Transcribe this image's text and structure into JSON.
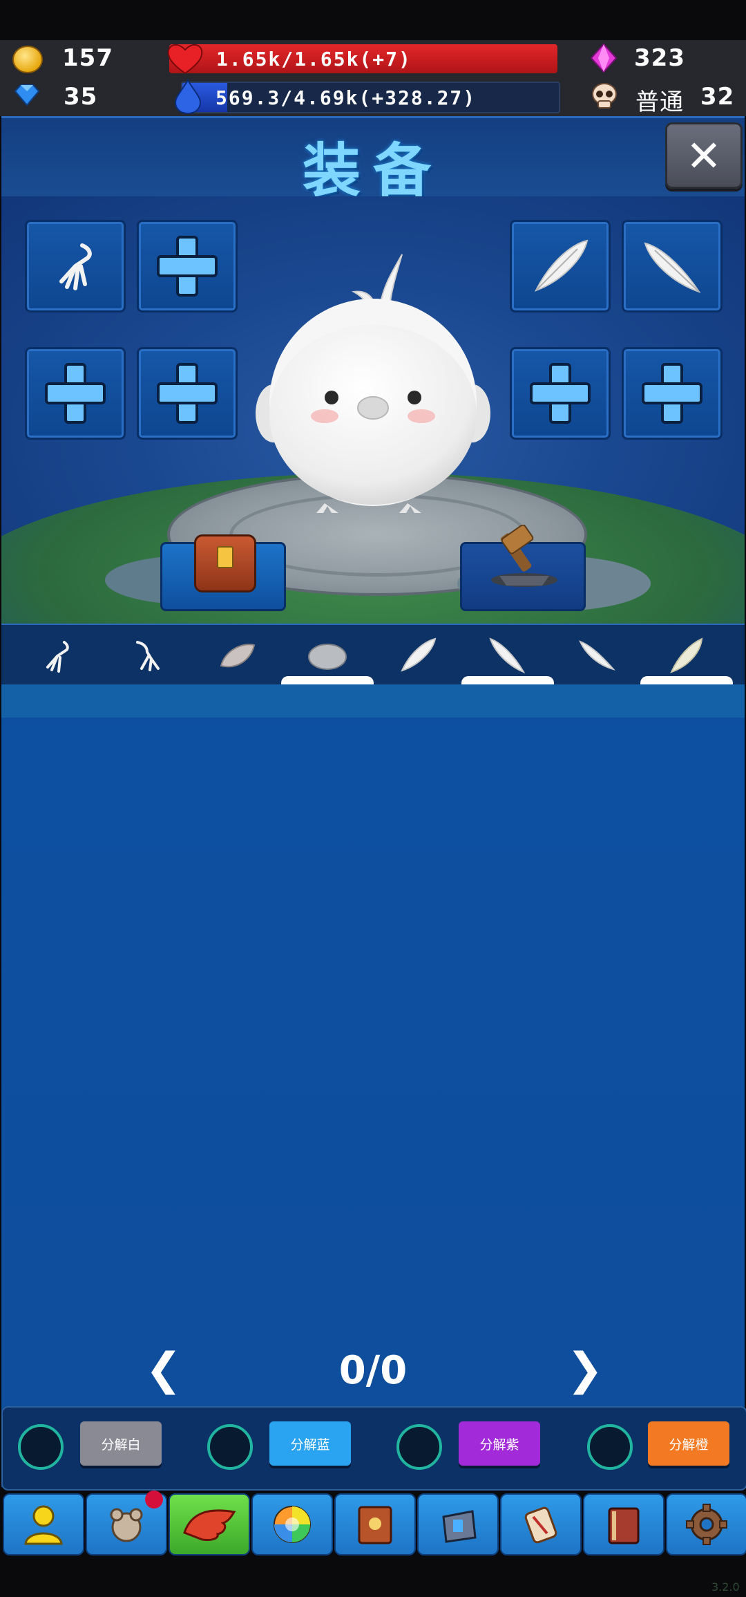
{
  "stats": {
    "gold": "157",
    "diamond": "35",
    "hp_text": "1.65k/1.65k(+7)",
    "hp_fraction": 1.0,
    "mana_text": "569.3/4.69k(+328.27)",
    "mana_fraction": 0.12,
    "gems": "323",
    "mode": "普通",
    "level": "32"
  },
  "colors": {
    "hp": "#c8191c",
    "mana": "#1b45c7",
    "accent": "#7fd6ff",
    "decompose_white": "#8a8a94",
    "decompose_blue": "#2aa3f0",
    "decompose_purple": "#a22ad8",
    "decompose_orange": "#f37a22"
  },
  "title": "装备",
  "close_icon": "close-icon",
  "equipment_slots": {
    "left": [
      "claw-icon",
      "plus-icon",
      "plus-icon",
      "plus-icon"
    ],
    "right": [
      "feather-icon",
      "feather-icon",
      "plus-icon",
      "plus-icon"
    ]
  },
  "scene_buttons": [
    "backpack-icon",
    "forge-hammer-icon"
  ],
  "item_strip": [
    "claw-icon",
    "claw-icon",
    "feather-icon",
    "stone-icon",
    "feather-icon",
    "feather-icon",
    "feather-icon",
    "feather-icon"
  ],
  "pager": {
    "text": "0/0"
  },
  "decompose": {
    "white": "分解白",
    "blue": "分解蓝",
    "purple": "分解紫",
    "orange": "分解橙"
  },
  "nav": [
    "profile-icon",
    "pet-icon",
    "wing-icon",
    "orb-icon",
    "book-icon",
    "bag-icon",
    "scroll-icon",
    "tome-icon",
    "gear-icon"
  ],
  "version": "3.2.0"
}
